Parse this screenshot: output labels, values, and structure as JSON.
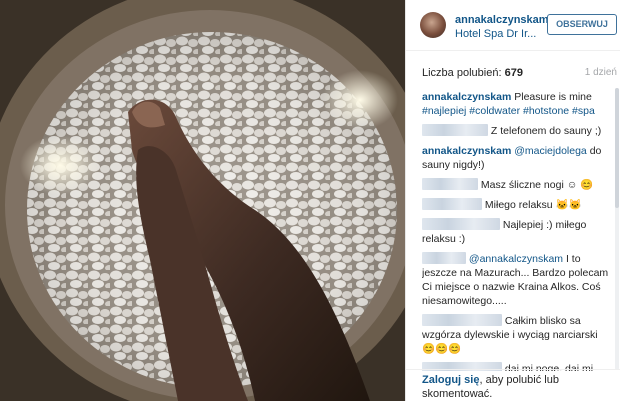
{
  "post": {
    "username": "annakalczynskam",
    "location": "Hotel Spa Dr Ir...",
    "follow_label": "OBSERWUJ",
    "likes_label": "Liczba polubień:",
    "likes_count": "679",
    "age": "1 dzień"
  },
  "comments": [
    {
      "user": "annakalczynskam",
      "text": "Pleasure is mine",
      "hashtags": [
        "#najlepiej",
        "#coldwater",
        "#hotstone",
        "#spa"
      ]
    },
    {
      "user": "",
      "text": "Z telefonem do sauny ;)"
    },
    {
      "user": "annakalczynskam",
      "mention": "@maciejdolega",
      "text": "do sauny nigdy!)"
    },
    {
      "user": "",
      "text": "Masz śliczne nogi ☺ 😊"
    },
    {
      "user": "",
      "text": "Miłego relaksu 🐱🐱"
    },
    {
      "user": "",
      "text": "Najlepiej :) miłego relaksu :)"
    },
    {
      "user": "",
      "mention": "@annakalczynskam",
      "text": "I to jeszcze na Mazurach... Bardzo polecam Ci miejsce o nazwie Kraina Alkos. Coś niesamowitego....."
    },
    {
      "user": "",
      "text": "Całkim blisko sa wzgórza dylewskie i wyciąg narciarski 😊😊😊"
    },
    {
      "user": "",
      "text": "daj mi nogę, daj mi nogę, ja ci nogi dać nie mogę, a jakiego to filmu?"
    }
  ],
  "footer": {
    "login_link": "Zaloguj się",
    "login_text": ", aby polubić lub skomentować."
  },
  "colors": {
    "link": "#125688",
    "follow_border": "#3f729b",
    "muted": "#a5a7aa"
  },
  "icons": {
    "avatar": "profile-photo"
  }
}
